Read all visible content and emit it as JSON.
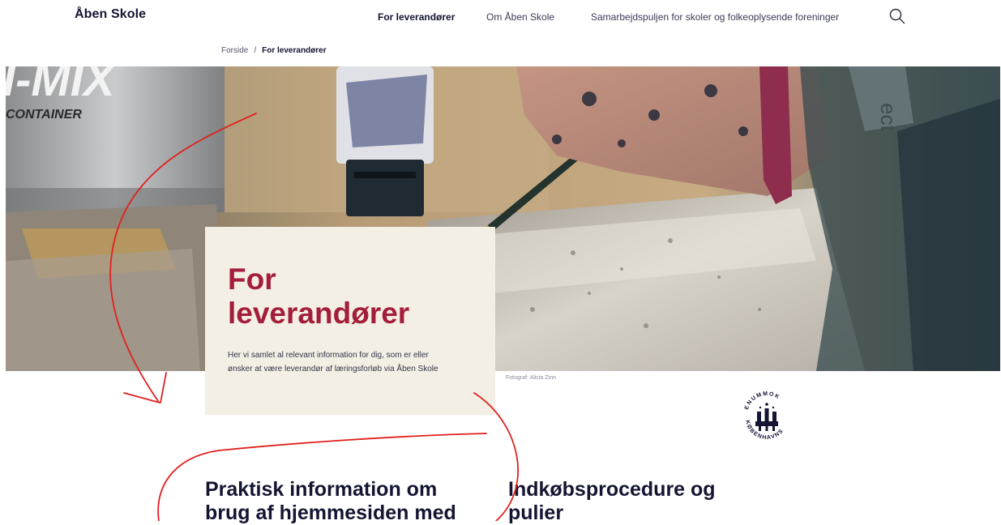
{
  "header": {
    "brand": "Åben Skole",
    "nav": [
      "For leverandører",
      "Om Åben Skole",
      "Samarbejdspuljen for skoler og folkeoplysende foreninger"
    ],
    "search_icon": "search-icon"
  },
  "breadcrumb": {
    "home": "Forside",
    "separator": "/",
    "current": "For leverandører"
  },
  "hero": {
    "title_line1": "For",
    "title_line2": "leverandører",
    "intro_line1": "Her vi samlet al relevant information for dig, som er eller",
    "intro_line2": "ønsker at være leverandør af læringsforløb via Åben Skole",
    "photo_credit": "Fotograf: Alicia Zinn",
    "can_text": "I-MIX",
    "can_subtext": "CONTAINER",
    "band_text": "ect",
    "title_color": "#a31e3b",
    "card_color": "#f4efe4"
  },
  "logo": {
    "name": "københavns-kommune-logo",
    "top_text": "ENUMMOK",
    "bottom_text": "KØBENHAVNS"
  },
  "sections": {
    "left_line1": "Praktisk information om",
    "left_line2": "brug af hjemmesiden med",
    "right_line1": "Indkøbsprocedure og",
    "right_line2": "pulier"
  },
  "annotation": {
    "color": "#e0211e"
  }
}
